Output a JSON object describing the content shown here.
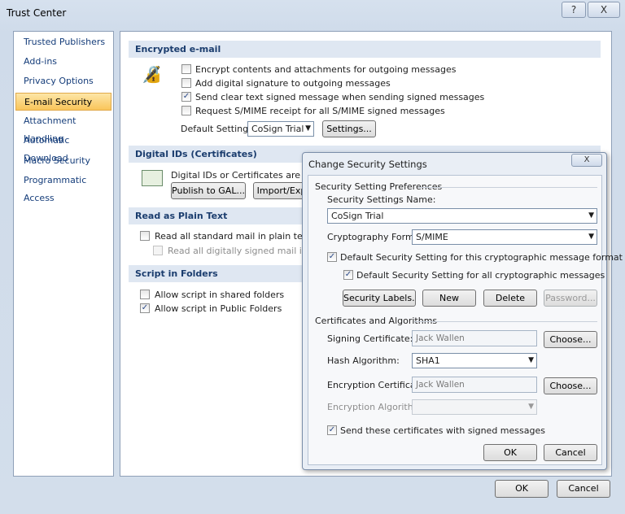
{
  "window": {
    "title": "Trust Center",
    "help_label": "?",
    "close_label": "X"
  },
  "sidebar": {
    "items": [
      {
        "label": "Trusted Publishers"
      },
      {
        "label": "Add-ins"
      },
      {
        "label": "Privacy Options"
      },
      {
        "label": "E-mail Security",
        "selected": true
      },
      {
        "label": "Attachment Handling"
      },
      {
        "label": "Automatic Download"
      },
      {
        "label": "Macro Security"
      },
      {
        "label": "Programmatic Access"
      }
    ]
  },
  "encrypted": {
    "header": "Encrypted e-mail",
    "options": [
      {
        "label": "Encrypt contents and attachments for outgoing messages",
        "checked": false
      },
      {
        "label": "Add digital signature to outgoing messages",
        "checked": false
      },
      {
        "label": "Send clear text signed message when sending signed messages",
        "checked": true
      },
      {
        "label": "Request S/MIME receipt for all S/MIME signed messages",
        "checked": false
      }
    ],
    "default_setting_label": "Default Setting:",
    "default_setting_value": "CoSign Trial",
    "settings_button": "Settings..."
  },
  "digital_ids": {
    "header": "Digital IDs (Certificates)",
    "description": "Digital IDs or Certificates are docu",
    "publish_button": "Publish to GAL...",
    "import_button": "Import/Exp"
  },
  "plain_text": {
    "header": "Read as Plain Text",
    "options": [
      {
        "label": "Read all standard mail in plain text",
        "checked": false
      },
      {
        "label": "Read all digitally signed mail in plai",
        "checked": false,
        "disabled": true
      }
    ]
  },
  "script": {
    "header": "Script in Folders",
    "options": [
      {
        "label": "Allow script in shared folders",
        "checked": false
      },
      {
        "label": "Allow script in Public Folders",
        "checked": true
      }
    ]
  },
  "footer": {
    "ok": "OK",
    "cancel": "Cancel"
  },
  "dialog": {
    "title": "Change Security Settings",
    "close_label": "X",
    "prefs_group": "Security Setting Preferences",
    "name_label": "Security Settings Name:",
    "name_value": "CoSign Trial",
    "crypto_label": "Cryptography Format:",
    "crypto_value": "S/MIME",
    "default_format": {
      "label": "Default Security Setting for this cryptographic message format",
      "checked": true
    },
    "default_all": {
      "label": "Default Security Setting for all cryptographic messages",
      "checked": true
    },
    "security_labels": "Security Labels...",
    "new": "New",
    "delete": "Delete",
    "password": "Password...",
    "certs_group": "Certificates and Algorithms",
    "signing_label": "Signing Certificate:",
    "signing_value": "Jack Wallen",
    "choose1": "Choose...",
    "hash_label": "Hash Algorithm:",
    "hash_value": "SHA1",
    "enc_label": "Encryption Certificate:",
    "enc_value": "Jack Wallen",
    "choose2": "Choose...",
    "enc_alg_label": "Encryption Algorithm:",
    "enc_alg_value": "",
    "send_certs": {
      "label": "Send these certificates with signed messages",
      "checked": true
    },
    "ok": "OK",
    "cancel": "Cancel"
  }
}
